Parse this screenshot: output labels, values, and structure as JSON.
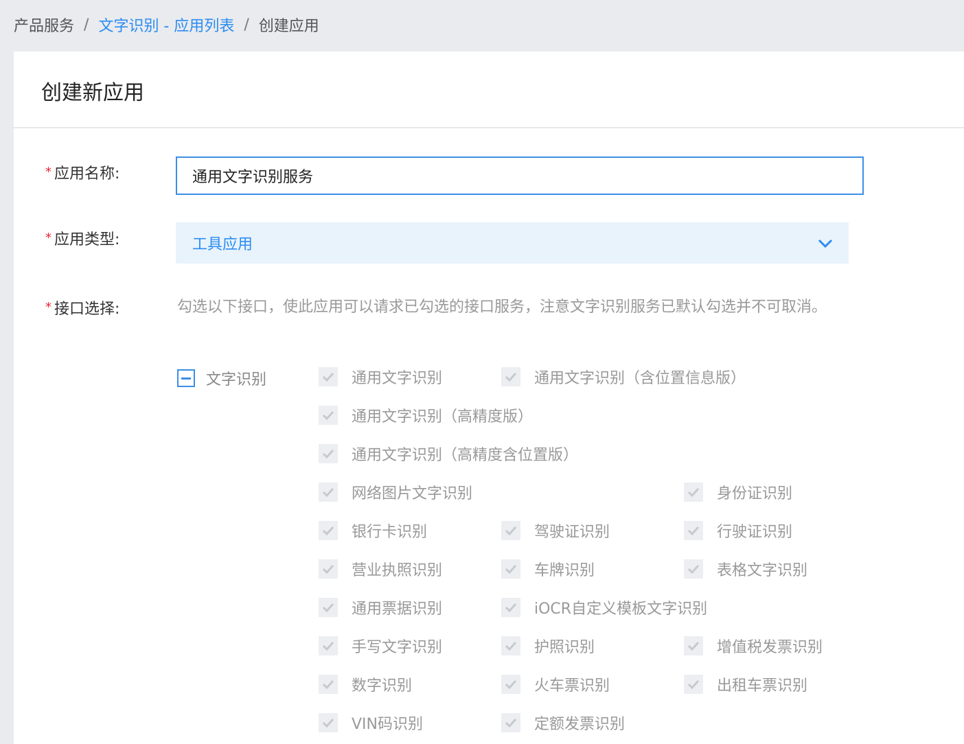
{
  "breadcrumb": {
    "root": "产品服务",
    "sep": "/",
    "middle": "文字识别 - 应用列表",
    "current": "创建应用"
  },
  "page": {
    "title": "创建新应用"
  },
  "form": {
    "required_mark": "*",
    "name_label": "应用名称:",
    "name_value": "通用文字识别服务",
    "type_label": "应用类型:",
    "type_value": "工具应用",
    "api_label": "接口选择:",
    "api_description": "勾选以下接口，使此应用可以请求已勾选的接口服务，注意文字识别服务已默认勾选并不可取消。",
    "group_label": "文字识别",
    "items": [
      "通用文字识别",
      "通用文字识别（含位置信息版）",
      "通用文字识别（高精度版）",
      "通用文字识别（高精度含位置版）",
      "网络图片文字识别",
      "身份证识别",
      "银行卡识别",
      "驾驶证识别",
      "行驶证识别",
      "营业执照识别",
      "车牌识别",
      "表格文字识别",
      "通用票据识别",
      "iOCR自定义模板文字识别",
      "手写文字识别",
      "护照识别",
      "增值税发票识别",
      "数字识别",
      "火车票识别",
      "出租车票识别",
      "VIN码识别",
      "定额发票识别"
    ]
  },
  "colors": {
    "accent": "#2d8cf0",
    "required": "#ee2233",
    "disabled_text": "#999999"
  }
}
